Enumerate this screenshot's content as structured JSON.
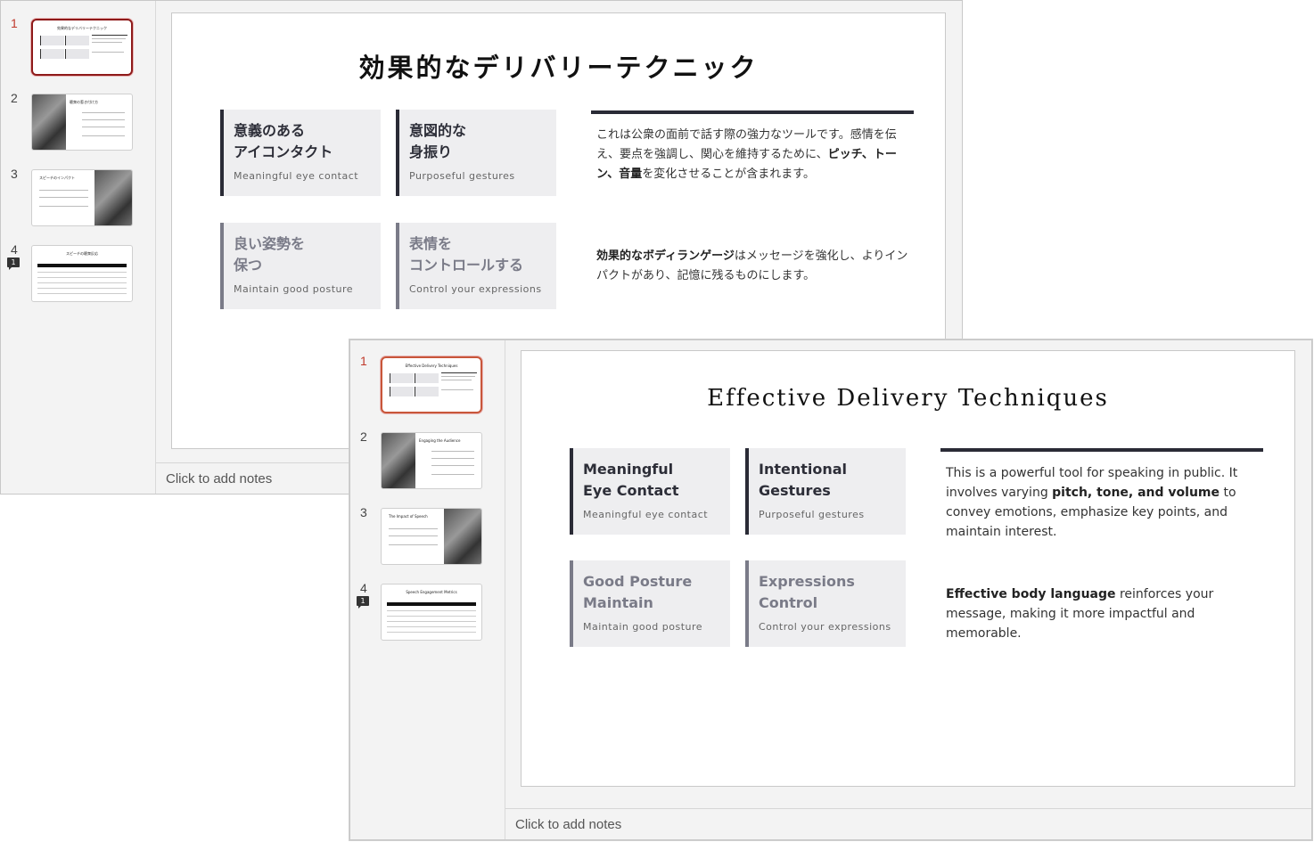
{
  "back_window": {
    "thumbnails": [
      {
        "number": "1",
        "title": "効果的なデリバリーテクニック",
        "active": true
      },
      {
        "number": "2",
        "title": "聴衆の惹き付け方"
      },
      {
        "number": "3",
        "title": "スピーチのインパクト"
      },
      {
        "number": "4",
        "title": "スピーチの聴衆反応",
        "comments": "1"
      }
    ],
    "slide": {
      "title": "効果的なデリバリーテクニック",
      "cards": [
        {
          "title": "意義のある\nアイコンタクト",
          "subtitle": "Meaningful eye contact"
        },
        {
          "title": "意図的な\n身振り",
          "subtitle": "Purposeful gestures"
        },
        {
          "title": "良い姿勢を\n保つ",
          "subtitle": "Maintain good posture"
        },
        {
          "title": "表情を\nコントロールする",
          "subtitle": "Control your expressions"
        }
      ],
      "para1": {
        "pre": "これは公衆の面前で話す際の強力なツールです。感情を伝え、要点を強調し、関心を維持するために、",
        "bold1": "ピッチ、トーン、",
        "bold2": "音量",
        "post": "を変化させることが含まれます。"
      },
      "para2": {
        "bold": "効果的なボディランゲージ",
        "post": "はメッセージを強化し、よりインパクトがあり、記憶に残るものにします。"
      }
    },
    "notes_placeholder": "Click to add notes"
  },
  "front_window": {
    "thumbnails": [
      {
        "number": "1",
        "title": "Effective Delivery Techniques",
        "active": true
      },
      {
        "number": "2",
        "title": "Engaging the Audience"
      },
      {
        "number": "3",
        "title": "The Impact of Speech"
      },
      {
        "number": "4",
        "title": "Speech Engagement Metrics",
        "comments": "1"
      }
    ],
    "slide": {
      "title": "Effective Delivery Techniques",
      "cards": [
        {
          "title": "Meaningful\nEye Contact",
          "subtitle": "Meaningful eye contact"
        },
        {
          "title": "Intentional\nGestures",
          "subtitle": "Purposeful gestures"
        },
        {
          "title": "Good Posture\nMaintain",
          "subtitle": "Maintain good posture"
        },
        {
          "title": "Expressions\nControl",
          "subtitle": "Control your expressions"
        }
      ],
      "para1": {
        "pre": "This is a powerful tool for speaking in public. It involves varying ",
        "bold": "pitch, tone, and volume",
        "post": " to convey emotions, emphasize key points, and maintain interest."
      },
      "para2": {
        "bold": "Effective body language",
        "post": " reinforces your message, making it more impactful and memorable."
      }
    },
    "notes_placeholder": "Click to add notes"
  },
  "colors": {
    "accent_dark": "#2a2b36",
    "active_thumb_back": "#8e1a1a",
    "active_thumb_front": "#c8563a",
    "card_bg": "#eeeef0"
  }
}
